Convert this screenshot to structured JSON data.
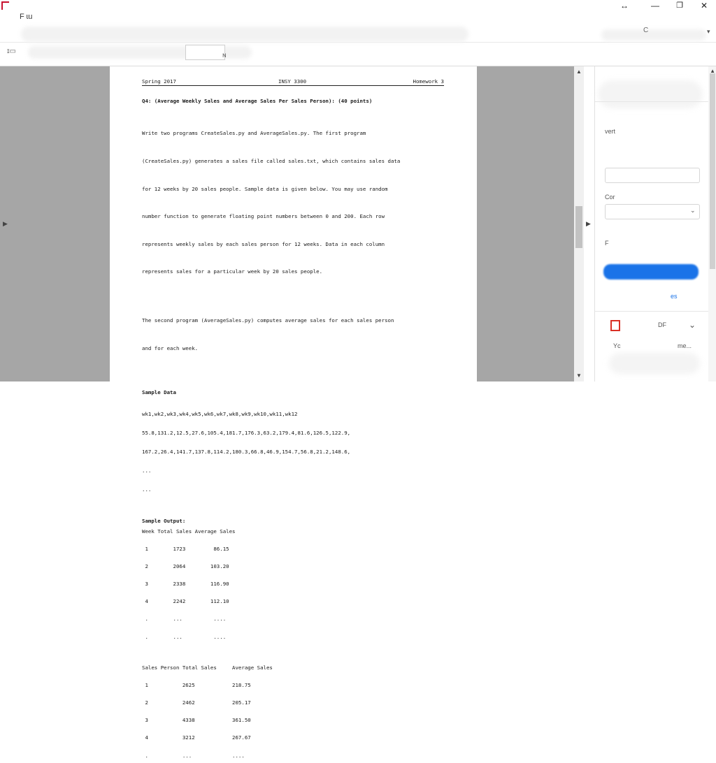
{
  "window": {
    "title": "F  ɩu",
    "controls": {
      "resize": "↔",
      "minimize": "—",
      "maximize": "❐",
      "close": "✕"
    }
  },
  "toolbar": {
    "dropdown": "▾",
    "icon_left": "ɪ▭",
    "icon_mid": "ɴ",
    "icon_right": "C"
  },
  "document": {
    "header": {
      "left": "Spring 2017",
      "center": "INSY 3300",
      "right": "Homework 3"
    },
    "question_title": "Q4: (Average Weekly Sales and Average Sales Per Sales Person): (40 points)",
    "paragraph1": [
      "Write two programs CreateSales.py and AverageSales.py. The first program",
      "(CreateSales.py) generates a sales file called sales.txt, which contains sales data",
      "for 12 weeks by 20 sales people. Sample data is given below. You may use random",
      "number function to generate floating point numbers between 0 and 200. Each row",
      "represents weekly sales by each sales person for 12 weeks. Data in each column",
      "represents sales for a particular week by 20 sales people."
    ],
    "paragraph2": [
      "The second program (AverageSales.py) computes average sales for each sales person",
      "and for each week."
    ],
    "sample_data_title": "Sample Data",
    "sample_data_lines": [
      "wk1,wk2,wk3,wk4,wk5,wk6,wk7,wk8,wk9,wk10,wk11,wk12",
      "55.8,131.2,12.5,27.6,105.4,181.7,176.3,63.2,179.4,81.6,126.5,122.9,",
      "167.2,26.4,141.7,137.8,114.2,180.3,66.8,46.9,154.7,56.8,21.2,148.6,",
      "...",
      "..."
    ],
    "sample_output_title": "Sample Output:",
    "week_table_header": "Week Total Sales Average Sales",
    "week_table_rows": [
      " 1        1723         86.15",
      " 2        2064        103.20",
      " 3        2338        116.90",
      " 4        2242        112.10",
      " .        ...          ....",
      " .        ...          ...."
    ],
    "person_table_header": "Sales Person Total Sales     Average Sales",
    "person_table_rows": [
      " 1           2625            218.75",
      " 2           2462            205.17",
      " 3           4338            361.50",
      " 4           3212            267.67",
      " .           ...             ....",
      " .           ...             ...."
    ]
  },
  "scrollbar": {
    "up": "▲",
    "down": "▼"
  },
  "side_arrows": {
    "left": "▶",
    "right": "▶"
  },
  "right_pane": {
    "row1": "vert",
    "row2": "Cor",
    "row3": "F",
    "row4": "es",
    "row5": "DF",
    "row6": "Yc",
    "row6_right": "me...",
    "dropdown": "⌄",
    "chevron": "⌄"
  }
}
